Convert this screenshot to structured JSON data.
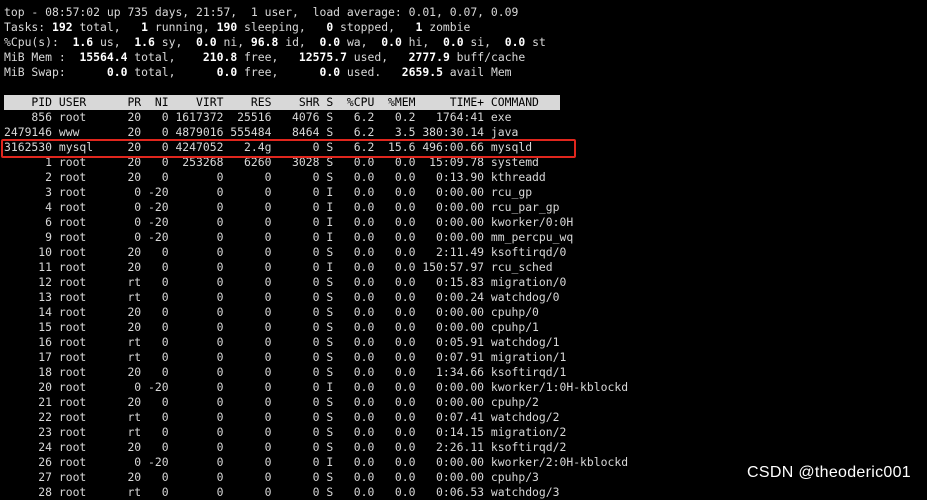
{
  "summary": {
    "uptime": "top - 08:57:02 up 735 days, 21:57,  1 user,  load average: 0.01, 0.07, 0.09",
    "tasks": {
      "total": "192",
      "running": "1",
      "sleeping": "190",
      "stopped": "0",
      "zombie": "1"
    },
    "cpu": {
      "us": "1.6",
      "sy": "1.6",
      "ni": "0.0",
      "id": "96.8",
      "wa": "0.0",
      "hi": "0.0",
      "si": "0.0",
      "st": "0.0"
    },
    "mem": {
      "total": "15564.4",
      "free": "210.8",
      "used": "12575.7",
      "buff_cache": "2777.9"
    },
    "swap": {
      "total": "0.0",
      "free": "0.0",
      "used": "0.0",
      "avail": "2659.5"
    }
  },
  "header": "    PID USER      PR  NI    VIRT    RES    SHR S  %CPU  %MEM     TIME+ COMMAND",
  "processes": [
    {
      "pid": "856",
      "user": "root",
      "pr": "20",
      "ni": "0",
      "virt": "1617372",
      "res": "25516",
      "shr": "4076",
      "s": "S",
      "cpu": "6.2",
      "mem": "0.2",
      "time": "1764:41",
      "cmd": "exe"
    },
    {
      "pid": "2479146",
      "user": "www",
      "pr": "20",
      "ni": "0",
      "virt": "4879016",
      "res": "555484",
      "shr": "8464",
      "s": "S",
      "cpu": "6.2",
      "mem": "3.5",
      "time": "380:30.14",
      "cmd": "java"
    },
    {
      "pid": "3162530",
      "user": "mysql",
      "pr": "20",
      "ni": "0",
      "virt": "4247052",
      "res": "2.4g",
      "shr": "0",
      "s": "S",
      "cpu": "6.2",
      "mem": "15.6",
      "time": "496:00.66",
      "cmd": "mysqld"
    },
    {
      "pid": "1",
      "user": "root",
      "pr": "20",
      "ni": "0",
      "virt": "253268",
      "res": "6260",
      "shr": "3028",
      "s": "S",
      "cpu": "0.0",
      "mem": "0.0",
      "time": "15:09.78",
      "cmd": "systemd"
    },
    {
      "pid": "2",
      "user": "root",
      "pr": "20",
      "ni": "0",
      "virt": "0",
      "res": "0",
      "shr": "0",
      "s": "S",
      "cpu": "0.0",
      "mem": "0.0",
      "time": "0:13.90",
      "cmd": "kthreadd"
    },
    {
      "pid": "3",
      "user": "root",
      "pr": "0",
      "ni": "-20",
      "virt": "0",
      "res": "0",
      "shr": "0",
      "s": "I",
      "cpu": "0.0",
      "mem": "0.0",
      "time": "0:00.00",
      "cmd": "rcu_gp"
    },
    {
      "pid": "4",
      "user": "root",
      "pr": "0",
      "ni": "-20",
      "virt": "0",
      "res": "0",
      "shr": "0",
      "s": "I",
      "cpu": "0.0",
      "mem": "0.0",
      "time": "0:00.00",
      "cmd": "rcu_par_gp"
    },
    {
      "pid": "6",
      "user": "root",
      "pr": "0",
      "ni": "-20",
      "virt": "0",
      "res": "0",
      "shr": "0",
      "s": "I",
      "cpu": "0.0",
      "mem": "0.0",
      "time": "0:00.00",
      "cmd": "kworker/0:0H"
    },
    {
      "pid": "9",
      "user": "root",
      "pr": "0",
      "ni": "-20",
      "virt": "0",
      "res": "0",
      "shr": "0",
      "s": "I",
      "cpu": "0.0",
      "mem": "0.0",
      "time": "0:00.00",
      "cmd": "mm_percpu_wq"
    },
    {
      "pid": "10",
      "user": "root",
      "pr": "20",
      "ni": "0",
      "virt": "0",
      "res": "0",
      "shr": "0",
      "s": "S",
      "cpu": "0.0",
      "mem": "0.0",
      "time": "2:11.49",
      "cmd": "ksoftirqd/0"
    },
    {
      "pid": "11",
      "user": "root",
      "pr": "20",
      "ni": "0",
      "virt": "0",
      "res": "0",
      "shr": "0",
      "s": "I",
      "cpu": "0.0",
      "mem": "0.0",
      "time": "150:57.97",
      "cmd": "rcu_sched"
    },
    {
      "pid": "12",
      "user": "root",
      "pr": "rt",
      "ni": "0",
      "virt": "0",
      "res": "0",
      "shr": "0",
      "s": "S",
      "cpu": "0.0",
      "mem": "0.0",
      "time": "0:15.83",
      "cmd": "migration/0"
    },
    {
      "pid": "13",
      "user": "root",
      "pr": "rt",
      "ni": "0",
      "virt": "0",
      "res": "0",
      "shr": "0",
      "s": "S",
      "cpu": "0.0",
      "mem": "0.0",
      "time": "0:00.24",
      "cmd": "watchdog/0"
    },
    {
      "pid": "14",
      "user": "root",
      "pr": "20",
      "ni": "0",
      "virt": "0",
      "res": "0",
      "shr": "0",
      "s": "S",
      "cpu": "0.0",
      "mem": "0.0",
      "time": "0:00.00",
      "cmd": "cpuhp/0"
    },
    {
      "pid": "15",
      "user": "root",
      "pr": "20",
      "ni": "0",
      "virt": "0",
      "res": "0",
      "shr": "0",
      "s": "S",
      "cpu": "0.0",
      "mem": "0.0",
      "time": "0:00.00",
      "cmd": "cpuhp/1"
    },
    {
      "pid": "16",
      "user": "root",
      "pr": "rt",
      "ni": "0",
      "virt": "0",
      "res": "0",
      "shr": "0",
      "s": "S",
      "cpu": "0.0",
      "mem": "0.0",
      "time": "0:05.91",
      "cmd": "watchdog/1"
    },
    {
      "pid": "17",
      "user": "root",
      "pr": "rt",
      "ni": "0",
      "virt": "0",
      "res": "0",
      "shr": "0",
      "s": "S",
      "cpu": "0.0",
      "mem": "0.0",
      "time": "0:07.91",
      "cmd": "migration/1"
    },
    {
      "pid": "18",
      "user": "root",
      "pr": "20",
      "ni": "0",
      "virt": "0",
      "res": "0",
      "shr": "0",
      "s": "S",
      "cpu": "0.0",
      "mem": "0.0",
      "time": "1:34.66",
      "cmd": "ksoftirqd/1"
    },
    {
      "pid": "20",
      "user": "root",
      "pr": "0",
      "ni": "-20",
      "virt": "0",
      "res": "0",
      "shr": "0",
      "s": "I",
      "cpu": "0.0",
      "mem": "0.0",
      "time": "0:00.00",
      "cmd": "kworker/1:0H-kblockd"
    },
    {
      "pid": "21",
      "user": "root",
      "pr": "20",
      "ni": "0",
      "virt": "0",
      "res": "0",
      "shr": "0",
      "s": "S",
      "cpu": "0.0",
      "mem": "0.0",
      "time": "0:00.00",
      "cmd": "cpuhp/2"
    },
    {
      "pid": "22",
      "user": "root",
      "pr": "rt",
      "ni": "0",
      "virt": "0",
      "res": "0",
      "shr": "0",
      "s": "S",
      "cpu": "0.0",
      "mem": "0.0",
      "time": "0:07.41",
      "cmd": "watchdog/2"
    },
    {
      "pid": "23",
      "user": "root",
      "pr": "rt",
      "ni": "0",
      "virt": "0",
      "res": "0",
      "shr": "0",
      "s": "S",
      "cpu": "0.0",
      "mem": "0.0",
      "time": "0:14.15",
      "cmd": "migration/2"
    },
    {
      "pid": "24",
      "user": "root",
      "pr": "20",
      "ni": "0",
      "virt": "0",
      "res": "0",
      "shr": "0",
      "s": "S",
      "cpu": "0.0",
      "mem": "0.0",
      "time": "2:26.11",
      "cmd": "ksoftirqd/2"
    },
    {
      "pid": "26",
      "user": "root",
      "pr": "0",
      "ni": "-20",
      "virt": "0",
      "res": "0",
      "shr": "0",
      "s": "I",
      "cpu": "0.0",
      "mem": "0.0",
      "time": "0:00.00",
      "cmd": "kworker/2:0H-kblockd"
    },
    {
      "pid": "27",
      "user": "root",
      "pr": "20",
      "ni": "0",
      "virt": "0",
      "res": "0",
      "shr": "0",
      "s": "S",
      "cpu": "0.0",
      "mem": "0.0",
      "time": "0:00.00",
      "cmd": "cpuhp/3"
    },
    {
      "pid": "28",
      "user": "root",
      "pr": "rt",
      "ni": "0",
      "virt": "0",
      "res": "0",
      "shr": "0",
      "s": "S",
      "cpu": "0.0",
      "mem": "0.0",
      "time": "0:06.53",
      "cmd": "watchdog/3"
    }
  ],
  "highlight_color": "#e0261d",
  "watermark": "CSDN @theoderic001"
}
